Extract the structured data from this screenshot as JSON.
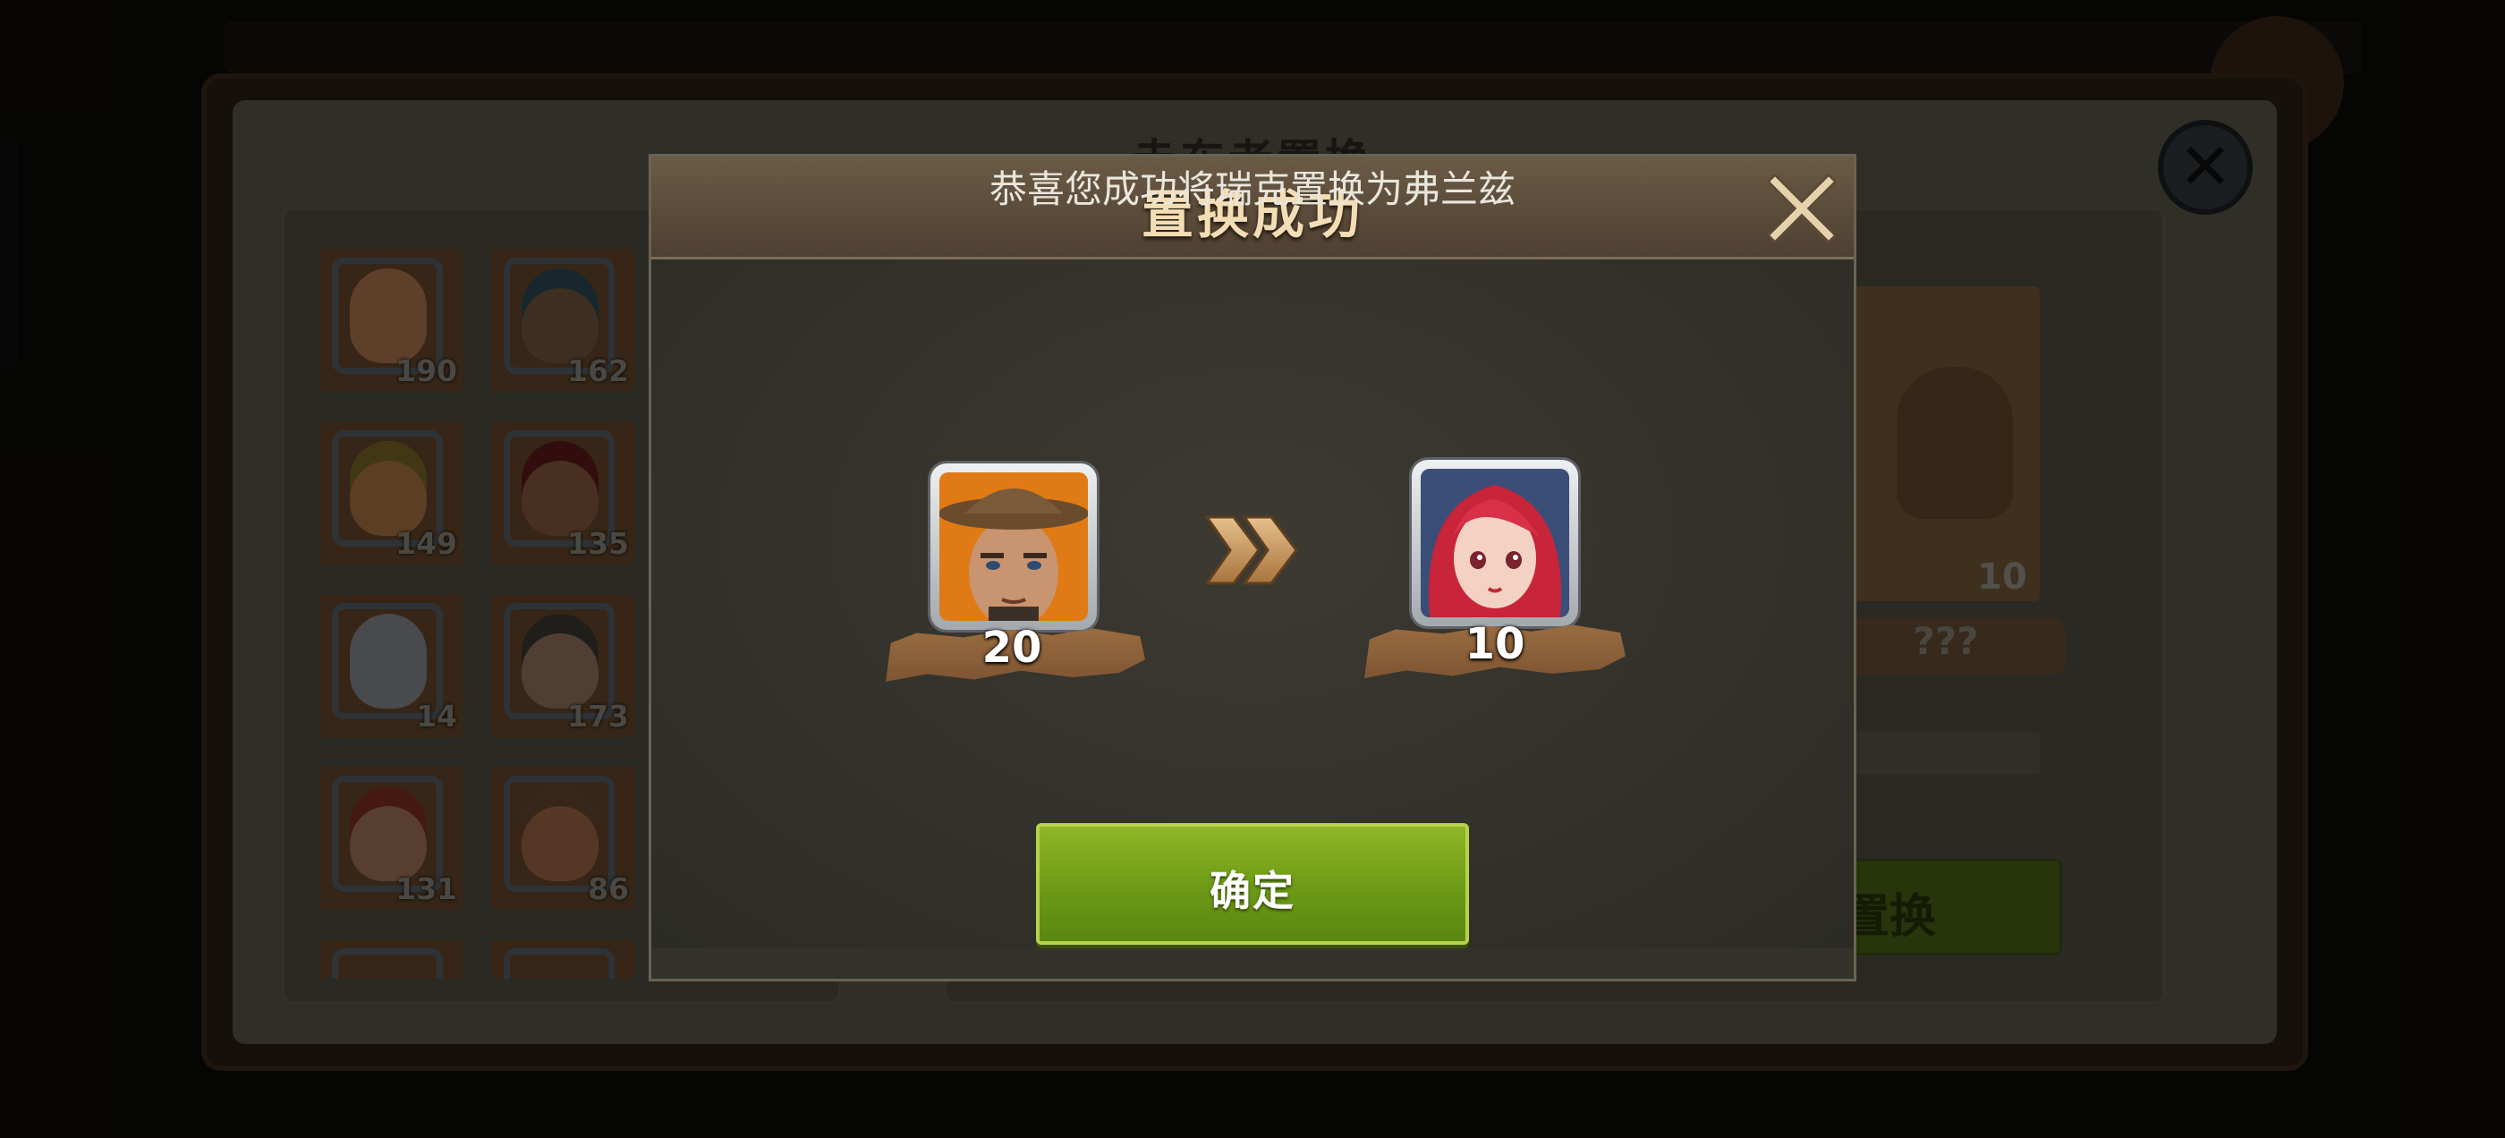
{
  "background": {
    "title": "赤东者置换",
    "hero_grid": [
      {
        "count": "190",
        "skin": "#b57a52",
        "hat": ""
      },
      {
        "count": "162",
        "skin": "#7a5a42",
        "hat": "#2f4b57"
      },
      {
        "count": "149",
        "skin": "#b07848",
        "hat": "#7d6a2a"
      },
      {
        "count": "135",
        "skin": "#8a5a40",
        "hat": "#5e1c1a"
      },
      {
        "count": "14",
        "skin": "#8d8f95",
        "hat": ""
      },
      {
        "count": "173",
        "skin": "#9a7860",
        "hat": "#3d3a35"
      },
      {
        "count": "131",
        "skin": "#a87858",
        "hat": "#803020"
      },
      {
        "count": "86",
        "skin": "#a66a4a",
        "hat": "#6a4a30"
      }
    ],
    "preview": {
      "count": "10",
      "name": "???"
    },
    "action_label": "置换"
  },
  "dialog": {
    "title": "置换成功",
    "message": "恭喜您成功将瑞克置换为弗兰兹",
    "from_hero": {
      "count": "20",
      "bg": "#e07a14"
    },
    "to_hero": {
      "count": "10",
      "bg": "#3a4e78"
    },
    "confirm_label": "确定"
  },
  "colors": {
    "accent_green": "#7aa81c",
    "title_gold": "#f3ddb4",
    "ribbon_brown": "#8b5e38"
  }
}
